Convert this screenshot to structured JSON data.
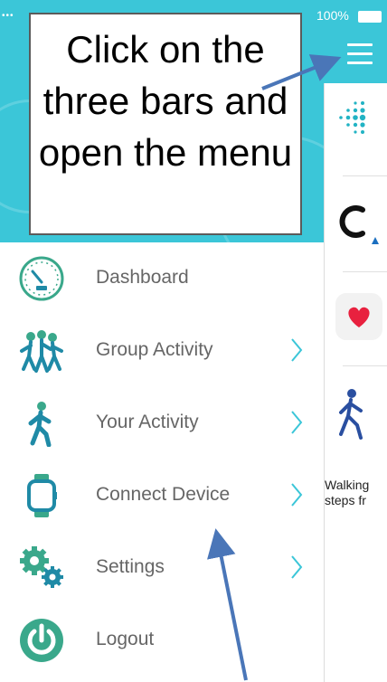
{
  "status_bar": {
    "dots": "•••",
    "battery": "100%"
  },
  "annotation": {
    "text": "Click on the three bars and open the menu"
  },
  "menu": {
    "items": [
      {
        "label": "Dashboard",
        "icon": "dashboard-gauge-icon",
        "chevron": false
      },
      {
        "label": "Group Activity",
        "icon": "group-activity-icon",
        "chevron": true
      },
      {
        "label": "Your Activity",
        "icon": "walking-person-icon",
        "chevron": true
      },
      {
        "label": "Connect Device",
        "icon": "smartwatch-icon",
        "chevron": true
      },
      {
        "label": "Settings",
        "icon": "gears-icon",
        "chevron": true
      },
      {
        "label": "Logout",
        "icon": "power-icon",
        "chevron": false
      }
    ]
  },
  "right_panel": {
    "snippet_line1": "Walking",
    "snippet_line2": "steps fr"
  },
  "colors": {
    "teal": "#3bc6d8",
    "icon_green": "#3aa88b",
    "icon_blue": "#1f8aa6",
    "arrow": "#4a76b8",
    "heart": "#e8213f"
  }
}
